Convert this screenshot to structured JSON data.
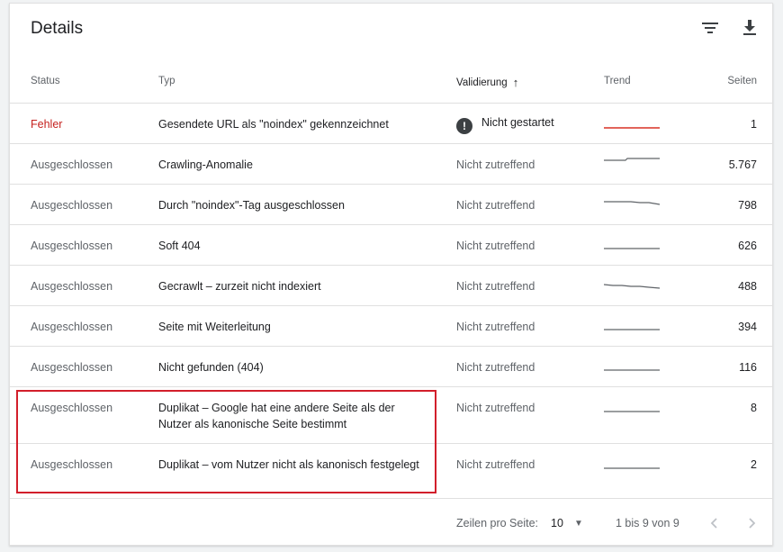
{
  "header": {
    "title": "Details",
    "filter_icon": "filter-icon",
    "download_icon": "download-icon"
  },
  "columns": {
    "status": "Status",
    "typ": "Typ",
    "validierung": "Validierung",
    "validierung_sort_icon": "arrow-up-icon",
    "trend": "Trend",
    "seiten": "Seiten"
  },
  "rows": [
    {
      "status": "Fehler",
      "typ": "Gesendete URL als \"noindex\" gekennzeichnet",
      "validierung": "Nicht gestartet",
      "seiten": "1"
    },
    {
      "status": "Ausgeschlossen",
      "typ": "Crawling-Anomalie",
      "validierung": "Nicht zutreffend",
      "seiten": "5.767"
    },
    {
      "status": "Ausgeschlossen",
      "typ": "Durch \"noindex\"-Tag ausgeschlossen",
      "validierung": "Nicht zutreffend",
      "seiten": "798"
    },
    {
      "status": "Ausgeschlossen",
      "typ": "Soft 404",
      "validierung": "Nicht zutreffend",
      "seiten": "626"
    },
    {
      "status": "Ausgeschlossen",
      "typ": "Gecrawlt – zurzeit nicht indexiert",
      "validierung": "Nicht zutreffend",
      "seiten": "488"
    },
    {
      "status": "Ausgeschlossen",
      "typ": "Seite mit Weiterleitung",
      "validierung": "Nicht zutreffend",
      "seiten": "394"
    },
    {
      "status": "Ausgeschlossen",
      "typ": "Nicht gefunden (404)",
      "validierung": "Nicht zutreffend",
      "seiten": "116"
    },
    {
      "status": "Ausgeschlossen",
      "typ": "Duplikat – Google hat eine andere Seite als der Nutzer als kanonische Seite bestimmt",
      "validierung": "Nicht zutreffend",
      "seiten": "8"
    },
    {
      "status": "Ausgeschlossen",
      "typ": "Duplikat – vom Nutzer nicht als kanonisch festgelegt",
      "validierung": "Nicht zutreffend",
      "seiten": "2"
    }
  ],
  "footer": {
    "rows_per_page_label": "Zeilen pro Seite:",
    "rows_per_page_value": "10",
    "range_label": "1 bis 9 von 9",
    "prev_icon": "chevron-left-icon",
    "next_icon": "chevron-right-icon"
  },
  "colors": {
    "error": "#c5221f",
    "highlight": "#d21f2b",
    "trend_error": "#d93025",
    "trend_default": "#5f6368"
  }
}
